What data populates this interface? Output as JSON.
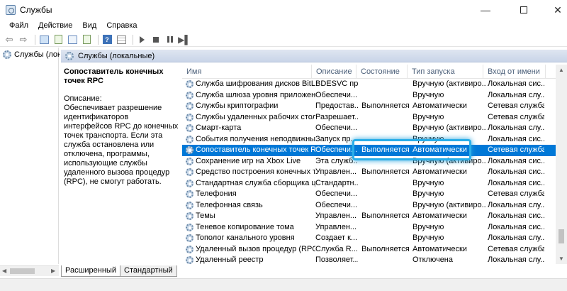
{
  "window": {
    "title": "Службы",
    "min": "—",
    "close": "✕"
  },
  "menu": [
    "Файл",
    "Действие",
    "Вид",
    "Справка"
  ],
  "tree": {
    "root_label": "Службы (локальные)"
  },
  "pane": {
    "header": "Службы (локальные)"
  },
  "description": {
    "title": "Сопоставитель конечных точек RPC",
    "label": "Описание:",
    "text": "Обеспечивает разрешение идентификаторов интерфейсов RPC до конечных точек транспорта. Если эта служба остановлена или отключена, программы, использующие службы удаленного вызова процедур (RPC), не смогут работать."
  },
  "columns": [
    "Имя",
    "Описание",
    "Состояние",
    "Тип запуска",
    "Вход от имени"
  ],
  "rows": [
    {
      "name": "Служба шифрования дисков BitLo...",
      "desc": "BDESVC пр...",
      "state": "",
      "start": "Вручную (активиро...",
      "login": "Локальная сис..."
    },
    {
      "name": "Служба шлюза уровня приложения",
      "desc": "Обеспечи...",
      "state": "",
      "start": "Вручную",
      "login": "Локальная слу..."
    },
    {
      "name": "Службы криптографии",
      "desc": "Предостав...",
      "state": "Выполняется",
      "start": "Автоматически",
      "login": "Сетевая служба"
    },
    {
      "name": "Службы удаленных рабочих столов",
      "desc": "Разрешает...",
      "state": "",
      "start": "Вручную",
      "login": "Сетевая служба"
    },
    {
      "name": "Смарт-карта",
      "desc": "Обеспечи...",
      "state": "",
      "start": "Вручную (активиро...",
      "login": "Локальная слу..."
    },
    {
      "name": "События получения неподвижных...",
      "desc": "Запуск пр...",
      "state": "",
      "start": "Вручную",
      "login": "Локальная сис..."
    },
    {
      "name": "Сопоставитель конечных точек RPC",
      "desc": "Обеспечи...",
      "state": "Выполняется",
      "start": "Автоматически",
      "login": "Сетевая служба",
      "selected": true
    },
    {
      "name": "Сохранение игр на Xbox Live",
      "desc": "Эта служб...",
      "state": "",
      "start": "Вручную (активиро...",
      "login": "Локальная сис..."
    },
    {
      "name": "Средство построения конечных то...",
      "desc": "Управлен...",
      "state": "Выполняется",
      "start": "Автоматически",
      "login": "Локальная сис..."
    },
    {
      "name": "Стандартная служба сборщика це...",
      "desc": "Стандартн...",
      "state": "",
      "start": "Вручную",
      "login": "Локальная сис..."
    },
    {
      "name": "Телефония",
      "desc": "Обеспечи...",
      "state": "",
      "start": "Вручную",
      "login": "Сетевая служба"
    },
    {
      "name": "Телефонная связь",
      "desc": "Обеспечи...",
      "state": "",
      "start": "Вручную (активиро...",
      "login": "Локальная слу..."
    },
    {
      "name": "Темы",
      "desc": "Управлен...",
      "state": "Выполняется",
      "start": "Автоматически",
      "login": "Локальная сис..."
    },
    {
      "name": "Теневое копирование тома",
      "desc": "Управлен...",
      "state": "",
      "start": "Вручную",
      "login": "Локальная сис..."
    },
    {
      "name": "Тополог канального уровня",
      "desc": "Создает к...",
      "state": "",
      "start": "Вручную",
      "login": "Локальная слу..."
    },
    {
      "name": "Удаленный вызов процедур (RPC)",
      "desc": "Служба R...",
      "state": "Выполняется",
      "start": "Автоматически",
      "login": "Сетевая служба"
    },
    {
      "name": "Удаленный реестр",
      "desc": "Позволяет...",
      "state": "",
      "start": "Отключена",
      "login": "Локальная слу..."
    }
  ],
  "tabs": [
    "Расширенный",
    "Стандартный"
  ],
  "colors": {
    "selection": "#0078d7",
    "highlight": "#2aaee8"
  }
}
